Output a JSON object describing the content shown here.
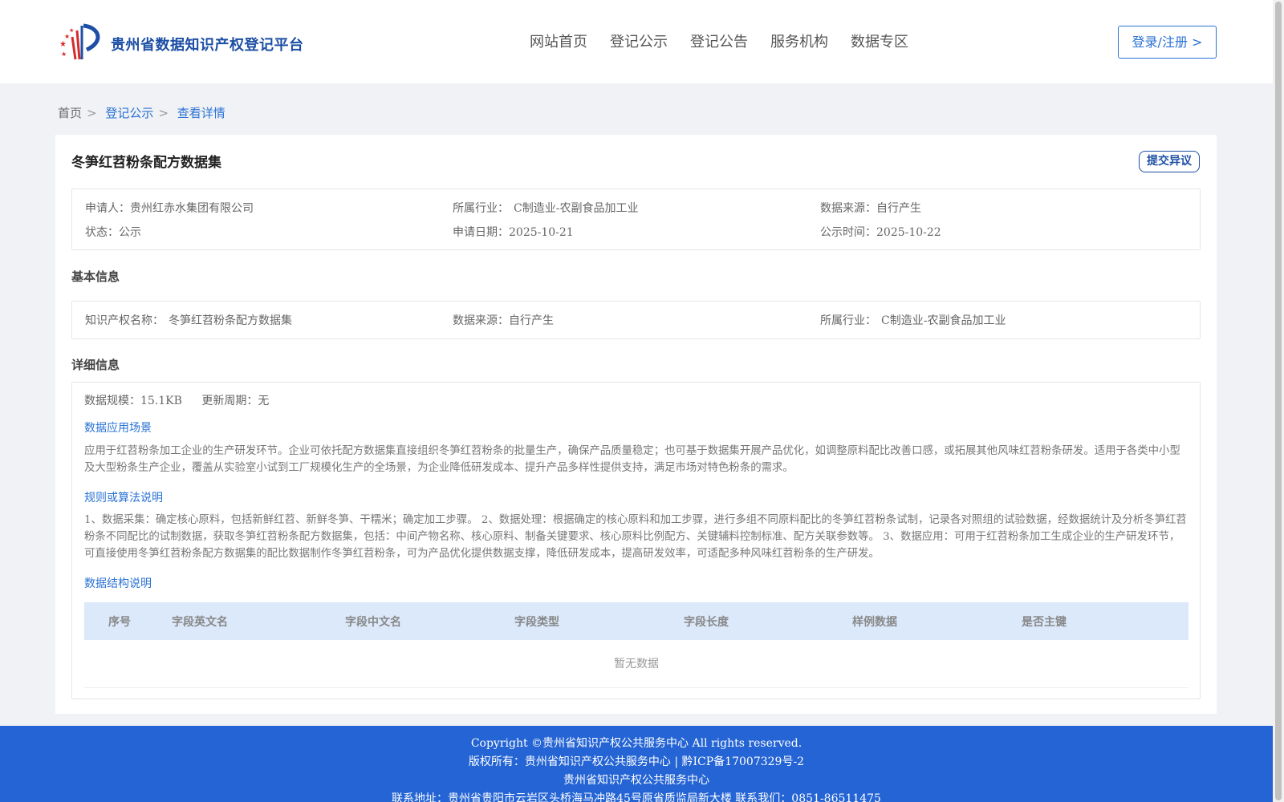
{
  "header": {
    "brand": "贵州省数据知识产权登记平台",
    "nav": [
      "网站首页",
      "登记公示",
      "登记公告",
      "服务机构",
      "数据专区"
    ],
    "login_label": "登录/注册 >"
  },
  "breadcrumb": {
    "home": "首页",
    "sep": ">",
    "level2": "登记公示",
    "current": "查看详情"
  },
  "detail": {
    "title": "冬笋红苕粉条配方数据集",
    "objection_label": "提交异议",
    "summary": {
      "applicant_label": "申请人：",
      "applicant": "贵州红赤水集团有限公司",
      "industry_label": "所属行业：",
      "industry": "C制造业-农副食品加工业",
      "source_label": "数据来源：",
      "source": "自行产生",
      "status_label": "状态：",
      "status": "公示",
      "apply_date_label": "申请日期：",
      "apply_date": "2025-10-21",
      "publish_date_label": "公示时间：",
      "publish_date": "2025-10-22"
    },
    "basic": {
      "heading": "基本信息",
      "ip_name_label": "知识产权名称：",
      "ip_name": "冬笋红苕粉条配方数据集",
      "source_label": "数据来源：",
      "source": "自行产生",
      "industry_label": "所属行业：",
      "industry": "C制造业-农副食品加工业"
    },
    "more": {
      "heading": "详细信息",
      "scale_label": "数据规模：",
      "scale": "15.1KB",
      "cycle_label": "更新周期：",
      "cycle": "无",
      "scenario_title": "数据应用场景",
      "scenario_text": "应用于红苕粉条加工企业的生产研发环节。企业可依托配方数据集直接组织冬笋红苕粉条的批量生产，确保产品质量稳定；也可基于数据集开展产品优化，如调整原料配比改善口感，或拓展其他风味红苕粉条研发。适用于各类中小型及大型粉条生产企业，覆盖从实验室小试到工厂规模化生产的全场景，为企业降低研发成本、提升产品多样性提供支持，满足市场对特色粉条的需求。",
      "rule_title": "规则或算法说明",
      "rule_text": "1、数据采集：确定核心原料，包括新鲜红苕、新鲜冬笋、干糯米；确定加工步骤。 2、数据处理：根据确定的核心原料和加工步骤，进行多组不同原料配比的冬笋红苕粉条试制，记录各对照组的试验数据，经数据统计及分析冬笋红苕粉条不同配比的试制数据，获取冬笋红苕粉条配方数据集，包括：中间产物名称、核心原料、制备关键要求、核心原料比例配方、关键辅料控制标准、配方关联参数等。 3、数据应用：可用于红苕粉条加工生成企业的生产研发环节，可直接使用冬笋红苕粉条配方数据集的配比数据制作冬笋红苕粉条，可为产品优化提供数据支撑，降低研发成本，提高研发效率，可适配多种风味红苕粉条的生产研发。",
      "structure_title": "数据结构说明",
      "columns": [
        "序号",
        "字段英文名",
        "字段中文名",
        "字段类型",
        "字段长度",
        "样例数据",
        "是否主键"
      ],
      "empty_text": "暂无数据"
    }
  },
  "footer": {
    "line1": "Copyright ©贵州省知识产权公共服务中心 All rights reserved.",
    "line2": "版权所有：贵州省知识产权公共服务中心 | 黔ICP备17007329号-2",
    "line3": "贵州省知识产权公共服务中心",
    "line4": "联系地址：贵州省贵阳市云岩区头桥海马冲路45号原省质监局新大楼 联系我们：0851-86511475"
  },
  "colors": {
    "accent": "#2a72d4",
    "brand": "#1d4fa5",
    "footer_bg": "#2464d4",
    "table_head_bg": "#dbe9fb"
  }
}
